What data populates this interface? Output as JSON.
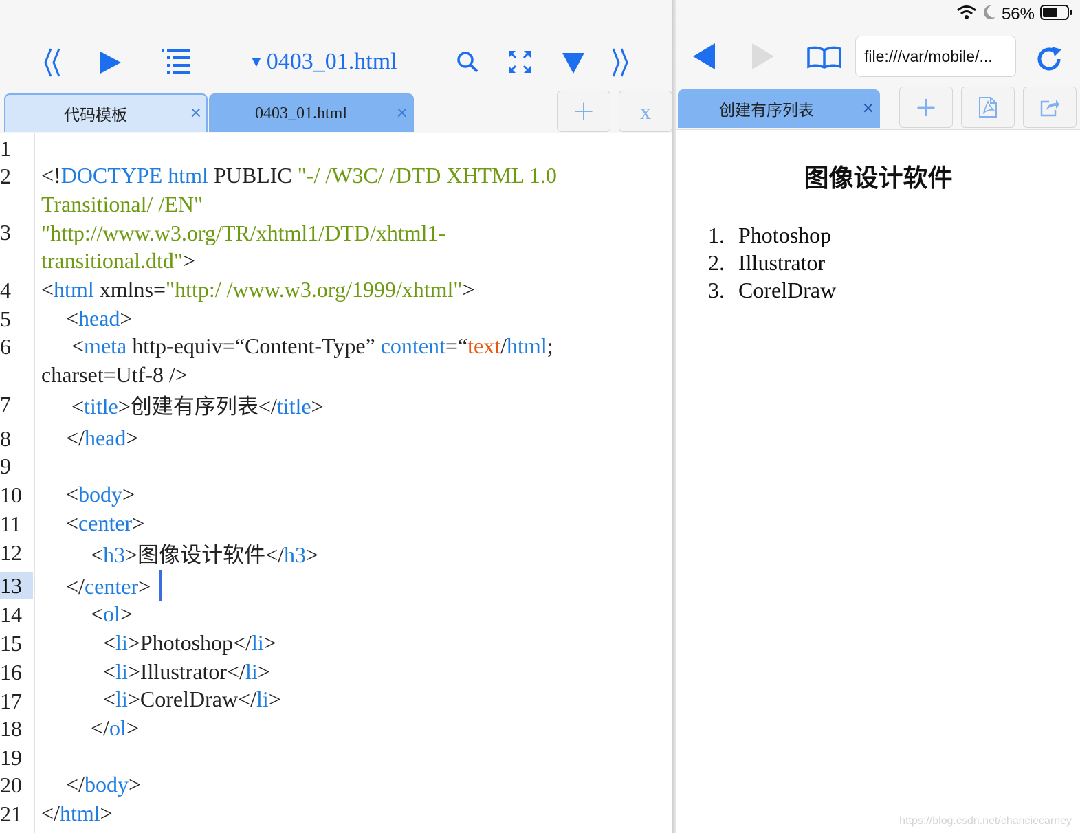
{
  "editor": {
    "toolbar": {
      "prev_icon": "double-chevron-left-icon",
      "run_icon": "play-icon",
      "outline_icon": "list-icon",
      "file_title": "0403_01.html",
      "search_icon": "search-icon",
      "fullscreen_icon": "expand-icon",
      "down_icon": "down-triangle-icon",
      "next_icon": "double-chevron-right-icon"
    },
    "tabs": [
      {
        "label": "代码模板",
        "close": "×"
      },
      {
        "label": "0403_01.html",
        "close": "×"
      }
    ],
    "add_tab": "+",
    "close_all": "x",
    "current_line": 13,
    "line_numbers": [
      "1",
      "2",
      "3",
      "4",
      "5",
      "6",
      "7",
      "8",
      "9",
      "10",
      "11",
      "12",
      "13",
      "14",
      "15",
      "16",
      "17",
      "18",
      "19",
      "20",
      "21"
    ],
    "code": {
      "l2a": "<!",
      "l2b": "DOCTYPE html",
      "l2c": " PUBLIC ",
      "l2d": "\"-/ /W3C/ /DTD XHTML 1.0",
      "l2e": "Transitional/ /EN\"",
      "l3a": "\"http://www.w3.org/TR/xhtml1/DTD/xhtml1-",
      "l3b": "transitional.dtd\"",
      "l3c": ">",
      "l4a": "<",
      "l4b": "html",
      "l4c": " xmlns=",
      "l4d": "\"http:/ /www.w3.org/1999/xhtml\"",
      "l4e": ">",
      "l5a": "<",
      "l5b": "head",
      "l5c": ">",
      "l6a": "<",
      "l6b": "meta",
      "l6c": " http-equiv=“Content-Type” ",
      "l6d": "content",
      "l6e": "=“",
      "l6f": "text",
      "l6g": "/",
      "l6h": "html",
      "l6i": ";",
      "l6j": "charset=Utf-8 />",
      "l7a": "<",
      "l7b": "title",
      "l7c": ">",
      "l7d": "创建有序列表",
      "l7e": "</",
      "l7f": "title",
      "l7g": ">",
      "l8a": "</",
      "l8b": "head",
      "l8c": ">",
      "l10a": "<",
      "l10b": "body",
      "l10c": ">",
      "l11a": "<",
      "l11b": "center",
      "l11c": ">",
      "l12a": "<",
      "l12b": "h3",
      "l12c": ">",
      "l12d": "图像设计软件",
      "l12e": "</",
      "l12f": "h3",
      "l12g": ">",
      "l13a": "</",
      "l13b": "center",
      "l13c": ">",
      "l14a": "<",
      "l14b": "ol",
      "l14c": ">",
      "l15a": "<",
      "l15b": "li",
      "l15c": ">Photoshop</",
      "l15d": "li",
      "l15e": ">",
      "l16a": "<",
      "l16b": "li",
      "l16c": ">Illustrator</",
      "l16d": "li",
      "l16e": ">",
      "l17a": "<",
      "l17b": "li",
      "l17c": ">CorelDraw</",
      "l17d": "li",
      "l17e": ">",
      "l18a": "</",
      "l18b": "ol",
      "l18c": ">",
      "l20a": "</",
      "l20b": "body",
      "l20c": ">",
      "l21a": "</",
      "l21b": "html",
      "l21c": ">"
    }
  },
  "browser": {
    "status": {
      "battery": "56%",
      "wifi_icon": "wifi-icon",
      "moon_icon": "moon-icon",
      "battery_icon": "battery-icon"
    },
    "toolbar": {
      "back_icon": "back-triangle-icon",
      "forward_icon": "forward-triangle-icon",
      "bookmarks_icon": "book-icon",
      "url": "file:///var/mobile/...",
      "reload_icon": "reload-icon"
    },
    "tab": {
      "label": "创建有序列表",
      "close": "×"
    },
    "add_tab": "+",
    "pdf_icon": "pdf-icon",
    "share_icon": "share-icon",
    "page": {
      "heading": "图像设计软件",
      "items": [
        {
          "num": "1.",
          "text": "Photoshop"
        },
        {
          "num": "2.",
          "text": "Illustrator"
        },
        {
          "num": "3.",
          "text": "CorelDraw"
        }
      ]
    }
  },
  "watermark": "https://blog.csdn.net/chanciecarney",
  "colors": {
    "accent": "#1e6ff0",
    "tag": "#1f7de0",
    "string": "#6e9a12",
    "value": "#e8580c",
    "tab_active": "#7fb3f2"
  }
}
